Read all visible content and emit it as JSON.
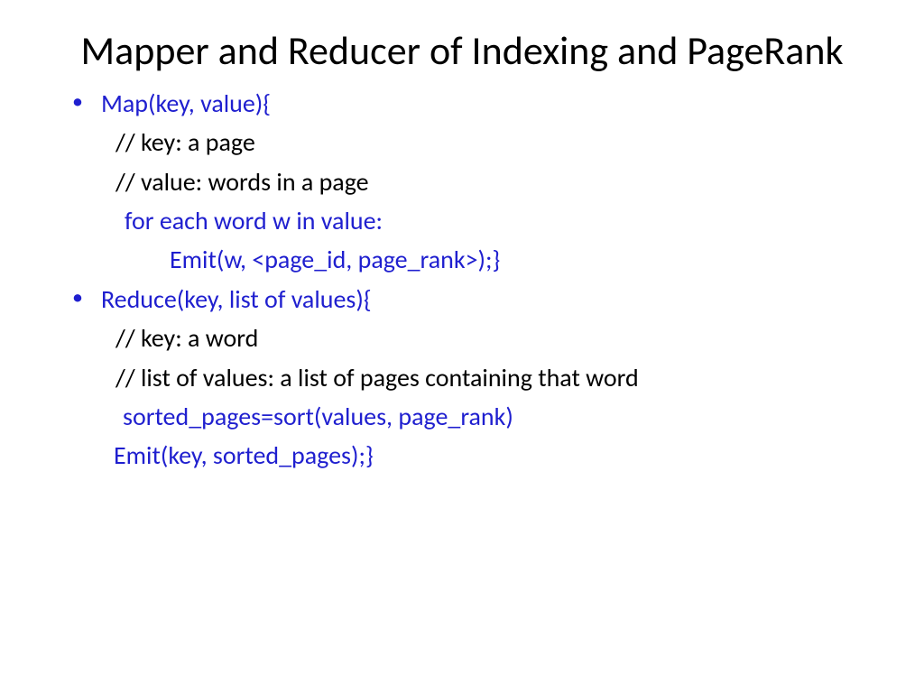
{
  "title": "Mapper and Reducer of Indexing and PageRank",
  "map": {
    "signature": "Map(key, value){",
    "comment_key": "// key: a page",
    "comment_value": "// value: words in a page",
    "loop": "for each word w in value:",
    "emit": "Emit(w, <page_id, page_rank>);}"
  },
  "reduce": {
    "signature": "Reduce(key, list of values){",
    "comment_key": "// key: a word",
    "comment_list": "// list of values: a list of pages containing that word",
    "sort": "sorted_pages=sort(values, page_rank)",
    "emit": "Emit(key, sorted_pages);}"
  }
}
